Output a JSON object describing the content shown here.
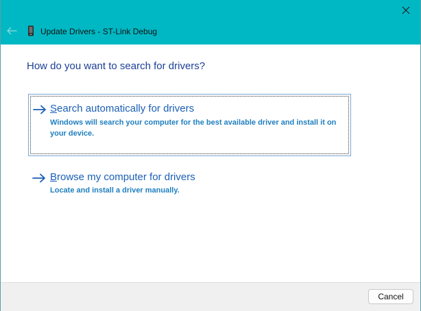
{
  "window": {
    "title": "Update Drivers - ST-Link Debug",
    "accent_color": "#00b8c4"
  },
  "icons": {
    "back": "back-arrow-icon",
    "device": "device-icon",
    "close": "close-icon",
    "option_arrow": "arrow-right-icon"
  },
  "content": {
    "question": "How do you want to search for drivers?",
    "options": [
      {
        "accelerator": "S",
        "title_rest": "earch automatically for drivers",
        "description": "Windows will search your computer for the best available driver and install it on your device."
      },
      {
        "accelerator": "B",
        "title_rest": "rowse my computer for drivers",
        "description": "Locate and install a driver manually."
      }
    ]
  },
  "footer": {
    "cancel_label": "Cancel"
  }
}
